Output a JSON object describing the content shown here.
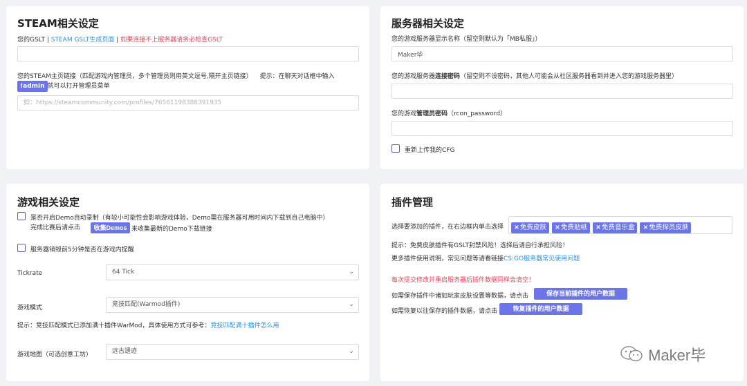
{
  "steam": {
    "title": "STEAM相关设定",
    "gslt_label": "您的GSLT",
    "sep1": "|",
    "gslt_link": "STEAM GSLT生成页面",
    "sep2": "|",
    "gslt_warning": "如果连接不上服务器请务必检查GSLT",
    "gslt_value": "",
    "profile_label": "您的STEAM主页链接（匹配游戏内管理员，多个管理员则用英文逗号,隔开主页链接）",
    "profile_hint": "提示：在聊天对话框中输入",
    "admin_cmd": "!admin",
    "profile_hint2": "就可以打开管理员菜单",
    "profile_placeholder": "如：https://steamcommunity.com/profiles/76561198388391935"
  },
  "server": {
    "title": "服务器相关设定",
    "name_label": "您的游戏服务器显示名称（留空则默认为「MB私服」）",
    "name_value": "Maker毕",
    "pw_label_a": "您的游戏服务器",
    "pw_label_b": "连接密码",
    "pw_label_c": "（留空则不设密码，其他人可能会从社区服务器看到并进入您的游戏服务器里）",
    "pw_value": "",
    "rcon_label_a": "您的游戏",
    "rcon_label_b": "管理员密码",
    "rcon_label_c": "（rcon_password）",
    "rcon_value": "",
    "reupload_label": "重新上传我的CFG"
  },
  "game": {
    "title": "游戏相关设定",
    "demo_label": "是否开启Demo自动录制（有较小可能性会影响游戏体验，Demo需在服务器可用时间内下载到自己电脑中）",
    "demo_sub_a": "完成比赛后请点击",
    "demo_btn": "收集Demos",
    "demo_sub_b": "来收集最新的Demo下载链接",
    "remind_label": "服务器销毁前5分钟是否在游戏内提醒",
    "tickrate_label": "Tickrate",
    "tickrate_value": "64 Tick",
    "mode_label": "游戏模式",
    "mode_value": "竞技匹配(Warmod插件)",
    "mode_hint_a": "提示：竞技匹配模式已添加满十插件WarMod，具体使用方式可参考：",
    "mode_hint_link": "竞技匹配满十插件怎么用",
    "map_label": "游戏地图（可选创意工坊）",
    "map_value": "远古遗迹"
  },
  "plugins": {
    "title": "插件管理",
    "select_label": "选择要添加的插件，在右边框内单击选择",
    "tags": [
      "免费皮肤",
      "免费贴纸",
      "免费音乐盒",
      "免费探员皮肤"
    ],
    "tag_remove_glyph": "×",
    "risk_hint": "提示：免费皮肤插件有GSLT封禁风险！选择后请自行承担风险！",
    "more_a": "更多插件使用说明，常见问题等请看链接",
    "more_link": "CS:GO服务器常见使用问题",
    "warning": "每次提交修改并重启服务器后插件数据同样会清空！",
    "save_a": "如需保存插件中诸如玩家皮肤设置等数据，请点击",
    "save_btn": "保存当前插件的用户数据",
    "restore_a": "如需恢复以往保存的插件数据，请点击",
    "restore_btn": "恢复插件的用户数据"
  },
  "watermark": {
    "text": "Maker毕"
  },
  "colors": {
    "accent": "#6b74e8",
    "link": "#2f8fd8",
    "warning": "#e0445a",
    "background": "#f0f2f5"
  },
  "icons": {
    "dropdown": "chevron-down-icon",
    "watermark": "wechat-icon"
  }
}
